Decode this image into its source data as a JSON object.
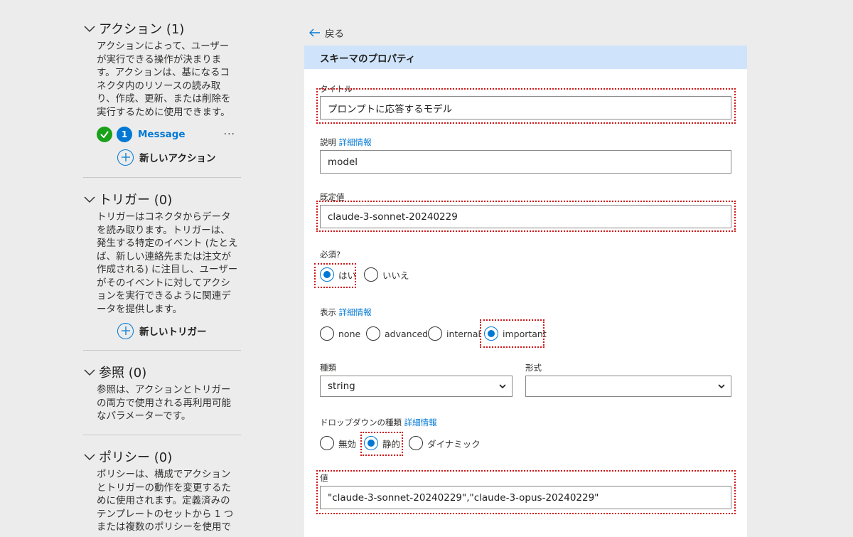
{
  "sidebar": {
    "actions": {
      "title": "アクション (1)",
      "desc": "アクションによって、ユーザーが実行できる操作が決まります。アクションは、基になるコネクタ内のリソースの読み取り、作成、更新、または削除を実行するために使用できます。",
      "item_number": "1",
      "item_label": "Message",
      "more": "···",
      "new_label": "新しいアクション"
    },
    "triggers": {
      "title": "トリガー (0)",
      "desc": "トリガーはコネクタからデータを読み取ります。トリガーは、発生する特定のイベント (たとえば、新しい連絡先または注文が作成される) に注目し、ユーザーがそのイベントに対してアクションを実行できるように関連データを提供します。",
      "new_label": "新しいトリガー"
    },
    "references": {
      "title": "参照 (0)",
      "desc": "参照は、アクションとトリガーの両方で使用される再利用可能なパラメーターです。"
    },
    "policies": {
      "title": "ポリシー (0)",
      "desc": "ポリシーは、構成でアクションとトリガーの動作を変更するために使用されます。定義済みのテンプレートのセットから 1 つまたは複数のポリシーを使用で"
    }
  },
  "back_label": "戻る",
  "panel": {
    "title": "スキーマのプロパティ",
    "title_label": "タイトル",
    "title_value": "プロンプトに応答するモデル",
    "desc_label": "説明",
    "more_info": "詳細情報",
    "desc_value": "model",
    "default_label": "既定値",
    "default_value": "claude-3-sonnet-20240229",
    "required_label": "必須?",
    "required_yes": "はい",
    "required_no": "いいえ",
    "visibility_label": "表示",
    "vis_none": "none",
    "vis_advanced": "advanced",
    "vis_internal": "internal",
    "vis_important": "important",
    "type_label": "種類",
    "type_value": "string",
    "format_label": "形式",
    "format_value": "",
    "dropdown_label": "ドロップダウンの種類",
    "dd_disabled": "無効",
    "dd_static": "静的",
    "dd_dynamic": "ダイナミック",
    "values_label": "値",
    "values_value": "\"claude-3-sonnet-20240229\",\"claude-3-opus-20240229\""
  },
  "colors": {
    "accent": "#0078d4",
    "header_bg": "#cfe4fa",
    "highlight": "#d11616",
    "success": "#1aa11a"
  }
}
